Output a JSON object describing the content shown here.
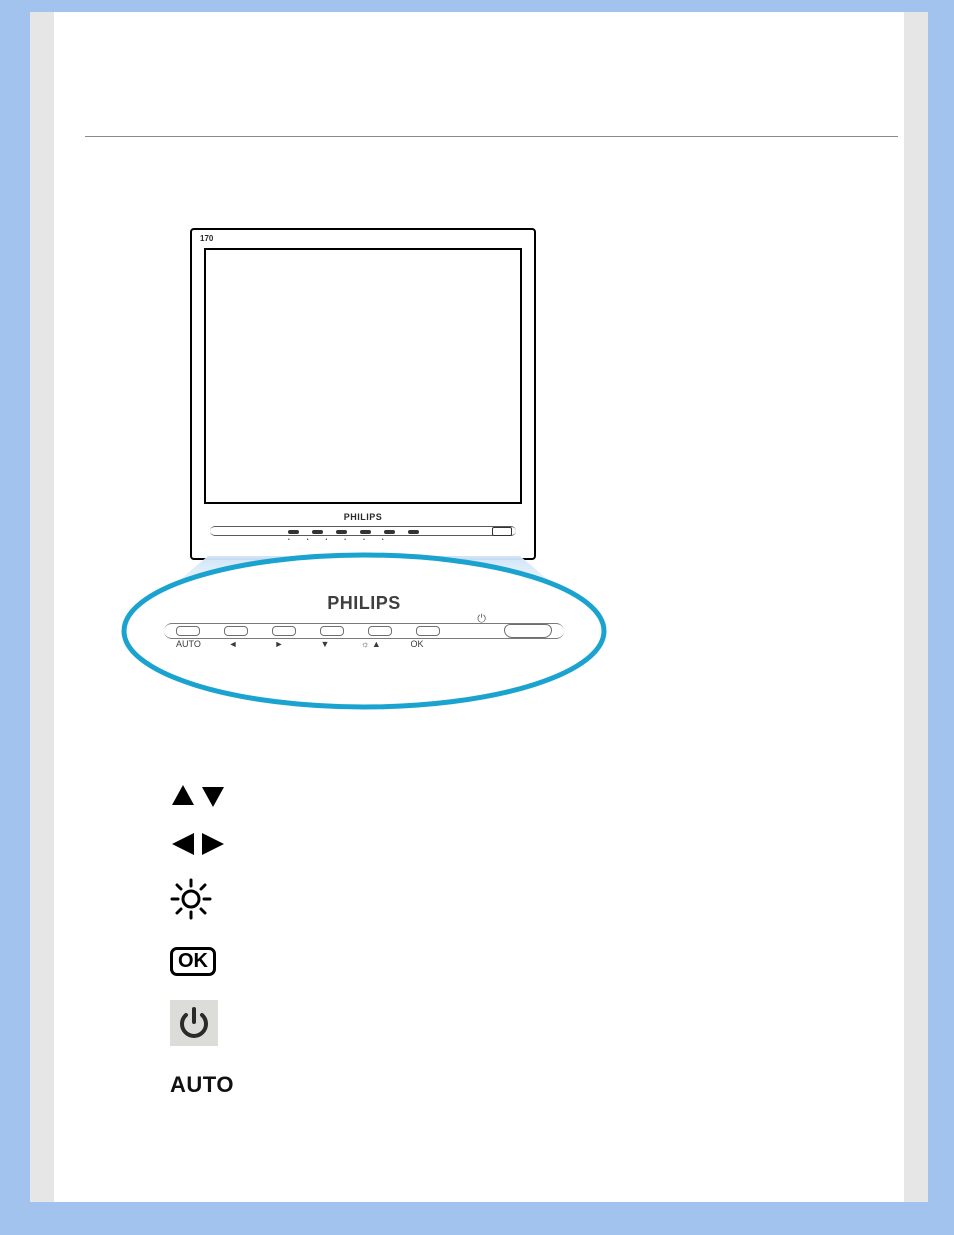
{
  "brand": "PHILIPS",
  "monitor": {
    "model_label": "170",
    "brand_label": "PHILIPS",
    "button_count": 6
  },
  "closeup": {
    "brand_label": "PHILIPS",
    "auto_label": "AUTO",
    "button_glyphs": [
      "AUTO",
      "◄",
      "►",
      "▼",
      "☼ ▲",
      "OK"
    ],
    "power_glyph": "⏻"
  },
  "legend": {
    "items": [
      {
        "id": "up-down",
        "kind": "icon",
        "glyph": "up-down-triangles"
      },
      {
        "id": "left-right",
        "kind": "icon",
        "glyph": "left-right-triangles"
      },
      {
        "id": "brightness",
        "kind": "icon",
        "glyph": "sun-outline"
      },
      {
        "id": "ok",
        "kind": "text",
        "label": "OK"
      },
      {
        "id": "power",
        "kind": "icon",
        "glyph": "power"
      },
      {
        "id": "auto",
        "kind": "text",
        "label": "AUTO"
      }
    ]
  }
}
